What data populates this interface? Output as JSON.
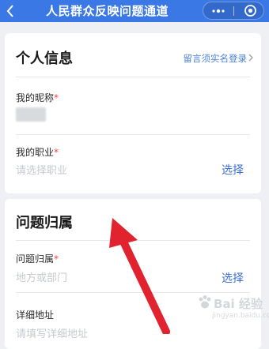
{
  "header": {
    "title": "人民群众反映问题通道",
    "back_icon": "chevron-left-icon",
    "more_icon": "more-dots-icon",
    "close_icon": "close-circle-icon"
  },
  "personal": {
    "title": "个人信息",
    "hint": "留言须实名登录",
    "nickname_label": "我的昵称",
    "job_label": "我的职业",
    "job_placeholder": "请选择职业",
    "job_select": "选择"
  },
  "problem": {
    "title": "问题归属",
    "belong_label": "问题归属",
    "belong_placeholder": "地方或部门",
    "belong_select": "选择",
    "address_label": "详细地址",
    "address_placeholder": "请填写详细地址"
  },
  "required_mark": "*",
  "watermark": {
    "text": "Bai 经验",
    "sub": "jingyan.baidu.com"
  },
  "colors": {
    "header": "#3a78e6",
    "link": "#3b6fd3",
    "arrow": "#e0232f"
  }
}
